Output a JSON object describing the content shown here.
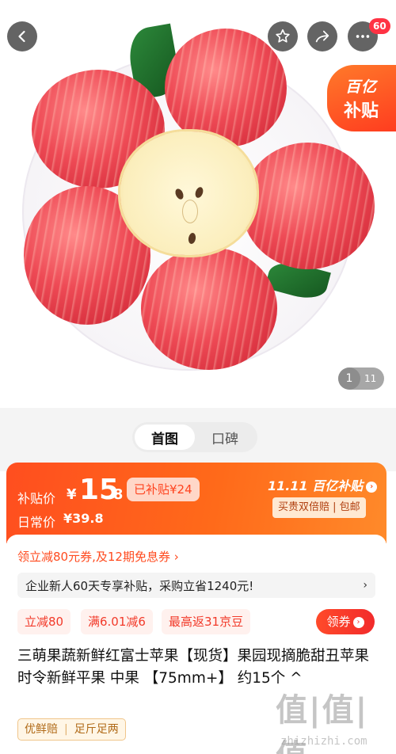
{
  "header": {
    "back_icon": "chevron-left-icon",
    "favorite_icon": "star-outline-icon",
    "share_icon": "share-arrow-icon",
    "more_icon": "more-dots-icon",
    "more_badge": "60"
  },
  "hero": {
    "subsidy_tag_line1": "百亿",
    "subsidy_tag_line2": "补贴",
    "page_current": "1",
    "page_total": "11"
  },
  "tabs": [
    {
      "label": "首图",
      "active": true
    },
    {
      "label": "口碑",
      "active": false
    }
  ],
  "price": {
    "subsidy_label": "补贴价",
    "currency": "¥",
    "integer": "15",
    "decimal": ".8",
    "subsidized_badge": "已补贴¥24",
    "daily_label": "日常价",
    "daily_price": "¥39.8",
    "promo_logo": "11.11 百亿补贴",
    "promo_tags": "买贵双倍赔 | 包邮",
    "accent_color": "#ff5a1e"
  },
  "coupons": {
    "summary": "领立减80元券,及12期免息券 ›",
    "enterprise_line": "企业新人60天专享补贴，采购立省1240元!",
    "enterprise_chevron": "›",
    "tags": [
      "立减80",
      "满6.01减6",
      "最高返31京豆"
    ],
    "claim_button": "领券"
  },
  "product": {
    "title": "三萌果蔬新鲜红富士苹果【现货】果园现摘脆甜丑苹果时令新鲜平果 中果 【75mm+】 约15个 ^",
    "service_tags": [
      "优鲜赔",
      "足斤足两"
    ]
  },
  "watermark": {
    "top": "值|值|值",
    "bottom": "zhizhizhi.com"
  }
}
